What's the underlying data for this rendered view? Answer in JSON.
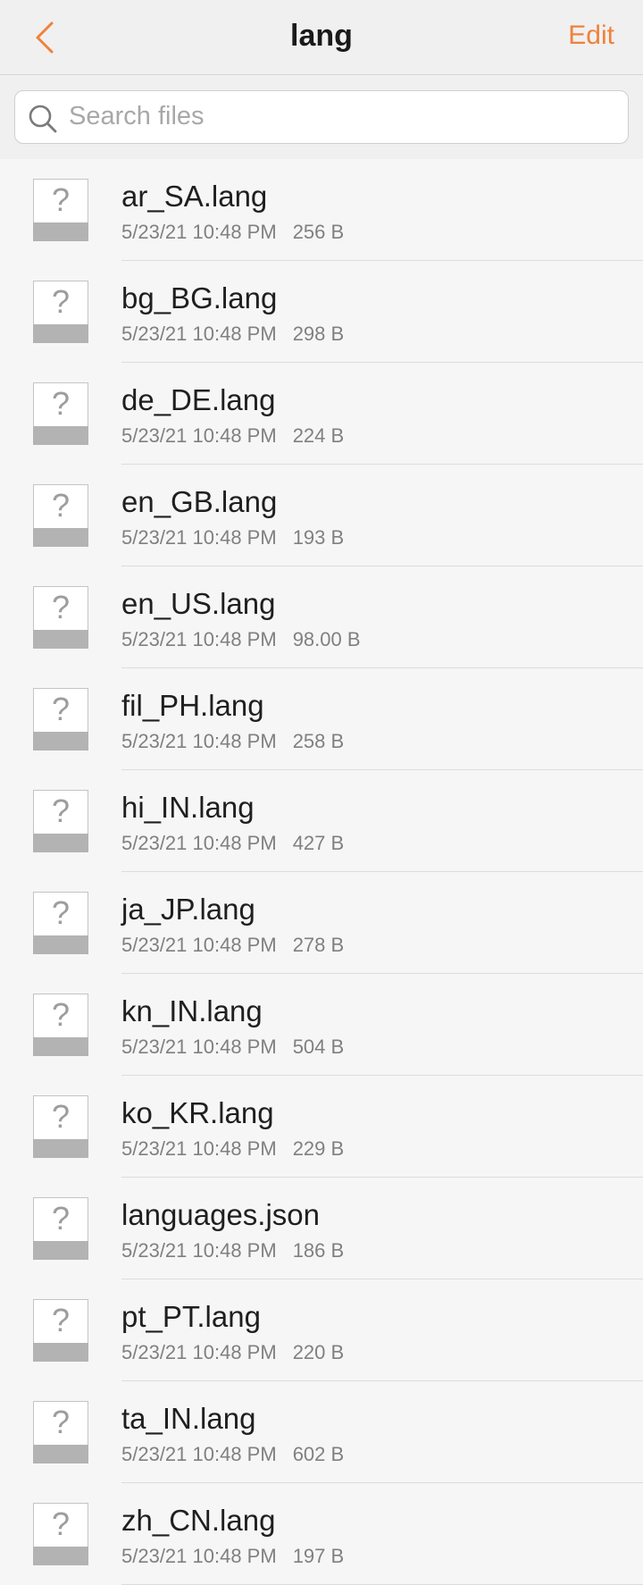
{
  "header": {
    "title": "lang",
    "edit_label": "Edit",
    "back_icon": "chevron-left-icon",
    "accent_color": "#f0813a"
  },
  "search": {
    "placeholder": "Search files",
    "value": "",
    "icon": "search-icon"
  },
  "files": [
    {
      "name": "ar_SA.lang",
      "date": "5/23/21 10:48 PM",
      "size": "256 B"
    },
    {
      "name": "bg_BG.lang",
      "date": "5/23/21 10:48 PM",
      "size": "298 B"
    },
    {
      "name": "de_DE.lang",
      "date": "5/23/21 10:48 PM",
      "size": "224 B"
    },
    {
      "name": "en_GB.lang",
      "date": "5/23/21 10:48 PM",
      "size": "193 B"
    },
    {
      "name": "en_US.lang",
      "date": "5/23/21 10:48 PM",
      "size": "98.00 B"
    },
    {
      "name": "fil_PH.lang",
      "date": "5/23/21 10:48 PM",
      "size": "258 B"
    },
    {
      "name": "hi_IN.lang",
      "date": "5/23/21 10:48 PM",
      "size": "427 B"
    },
    {
      "name": "ja_JP.lang",
      "date": "5/23/21 10:48 PM",
      "size": "278 B"
    },
    {
      "name": "kn_IN.lang",
      "date": "5/23/21 10:48 PM",
      "size": "504 B"
    },
    {
      "name": "ko_KR.lang",
      "date": "5/23/21 10:48 PM",
      "size": "229 B"
    },
    {
      "name": "languages.json",
      "date": "5/23/21 10:48 PM",
      "size": "186 B"
    },
    {
      "name": "pt_PT.lang",
      "date": "5/23/21 10:48 PM",
      "size": "220 B"
    },
    {
      "name": "ta_IN.lang",
      "date": "5/23/21 10:48 PM",
      "size": "602 B"
    },
    {
      "name": "zh_CN.lang",
      "date": "5/23/21 10:48 PM",
      "size": "197 B"
    }
  ],
  "file_icon": {
    "name": "unknown-file-icon",
    "glyph": "?"
  }
}
